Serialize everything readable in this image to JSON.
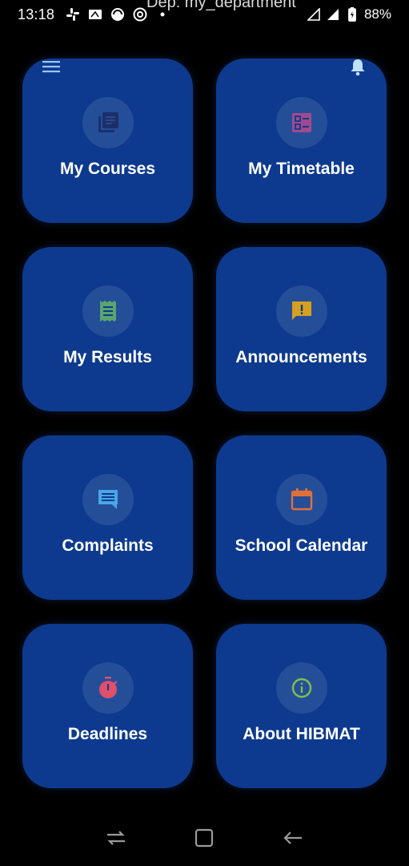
{
  "status_bar": {
    "time": "13:18",
    "title": "Dep: my_department",
    "battery": "88%"
  },
  "toolbar": {
    "menu_icon": "menu-icon",
    "notifications_icon": "bell-icon"
  },
  "tiles": [
    {
      "label": "My Courses",
      "icon": "library-books-icon",
      "icon_color": "#1b2f6b"
    },
    {
      "label": "My Timetable",
      "icon": "checklist-icon",
      "icon_color": "#a04a8c"
    },
    {
      "label": "My Results",
      "icon": "receipt-icon",
      "icon_color": "#5aa56e"
    },
    {
      "label": "Announcements",
      "icon": "announcement-icon",
      "icon_color": "#d6a020"
    },
    {
      "label": "Complaints",
      "icon": "chat-icon",
      "icon_color": "#4aa6e6"
    },
    {
      "label": "School Calendar",
      "icon": "calendar-icon",
      "icon_color": "#e0703a"
    },
    {
      "label": "Deadlines",
      "icon": "timer-icon",
      "icon_color": "#e0506a"
    },
    {
      "label": "About HIBMAT",
      "icon": "info-icon",
      "icon_color": "#7ec24a"
    }
  ],
  "colors": {
    "background": "#000000",
    "tile": "#0d3a8e"
  }
}
